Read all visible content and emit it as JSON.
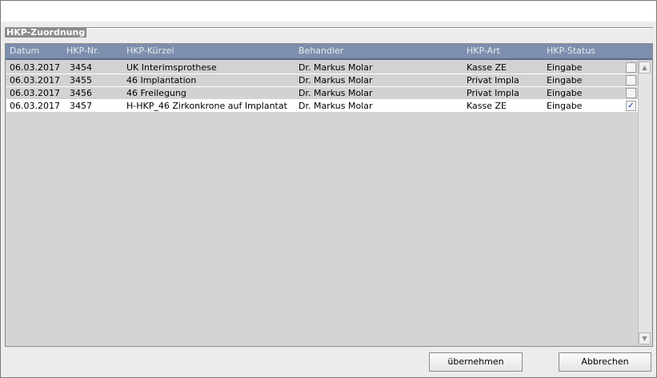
{
  "group": {
    "title": "HKP-Zuordnung"
  },
  "table": {
    "columns": [
      "Datum",
      "HKP-Nr.",
      "HKP-Kürzel",
      "Behandler",
      "HKP-Art",
      "HKP-Status"
    ],
    "rows": [
      {
        "datum": "06.03.2017",
        "nr": "3454",
        "kuerzel": "UK Interimsprothese",
        "behandler": "Dr. Markus Molar",
        "art": "Kasse ZE",
        "status": "Eingabe",
        "checked": ""
      },
      {
        "datum": "06.03.2017",
        "nr": "3455",
        "kuerzel": "46  Implantation",
        "behandler": "Dr. Markus Molar",
        "art": "Privat Impla",
        "status": "Eingabe",
        "checked": ""
      },
      {
        "datum": "06.03.2017",
        "nr": "3456",
        "kuerzel": "46 Freilegung",
        "behandler": "Dr. Markus Molar",
        "art": "Privat Impla",
        "status": "Eingabe",
        "checked": ""
      },
      {
        "datum": "06.03.2017",
        "nr": "3457",
        "kuerzel": "H-HKP_46 Zirkonkrone auf Implantat",
        "behandler": "Dr. Markus Molar",
        "art": "Kasse ZE",
        "status": "Eingabe",
        "checked": "✓"
      }
    ]
  },
  "scroll": {
    "up": "▲",
    "down": "▼"
  },
  "buttons": {
    "accept": "übernehmen",
    "cancel": "Abbrechen"
  },
  "colors": {
    "header": "#7d8fad",
    "row": "#d2d2d2",
    "selected_row": "#ffffff",
    "check": "#1a2ea8"
  }
}
